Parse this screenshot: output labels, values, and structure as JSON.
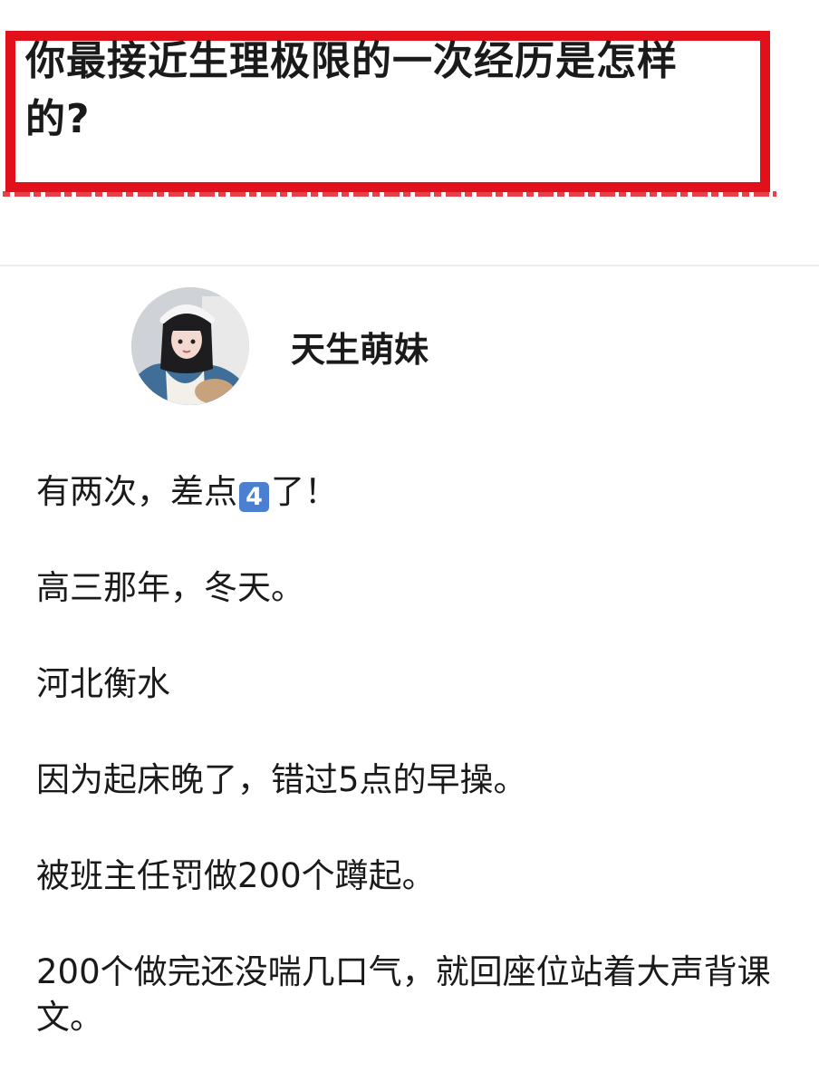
{
  "question": {
    "title": "你最接近生理极限的一次经历是怎样的?"
  },
  "author": {
    "name": "天生萌妹",
    "avatar_icon": "avatar-photo"
  },
  "answer": {
    "p1_before": "有两次，差点",
    "p1_emoji": "4",
    "p1_after": "了！",
    "paragraphs": [
      "高三那年，冬天。",
      "河北衡水",
      "因为起床晚了，错过5点的早操。",
      "被班主任罚做200个蹲起。",
      "200个做完还没喘几口气，就回座位站着大声背课文。"
    ]
  },
  "colors": {
    "frame_red": "#e1101a",
    "text": "#1a1a1a",
    "emoji_keycap": "#4a7fd1"
  }
}
